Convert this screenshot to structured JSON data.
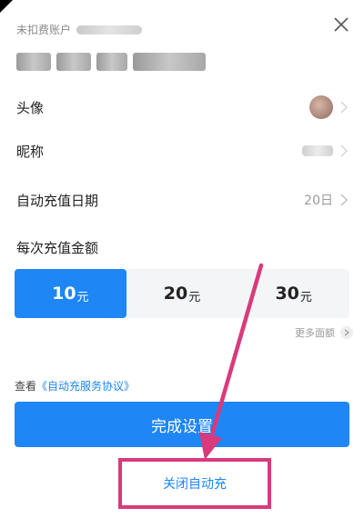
{
  "account": {
    "label": "未扣费账户"
  },
  "close_icon": "close-icon",
  "rows": {
    "avatar": {
      "label": "头像"
    },
    "nickname": {
      "label": "昵称"
    },
    "date": {
      "label": "自动充值日期",
      "value": "20日"
    }
  },
  "amount_section": {
    "title": "每次充值金额",
    "options": [
      {
        "value": "10",
        "unit": "元",
        "selected": true
      },
      {
        "value": "20",
        "unit": "元",
        "selected": false
      },
      {
        "value": "30",
        "unit": "元",
        "selected": false
      }
    ],
    "more_label": "更多面额"
  },
  "agreement": {
    "prefix": "查看",
    "link": "《自动充服务协议》"
  },
  "primary_button": "完成设置",
  "close_auto_button": "关闭自动充",
  "colors": {
    "accent": "#1e86f5",
    "annotation": "#d93a7c"
  }
}
